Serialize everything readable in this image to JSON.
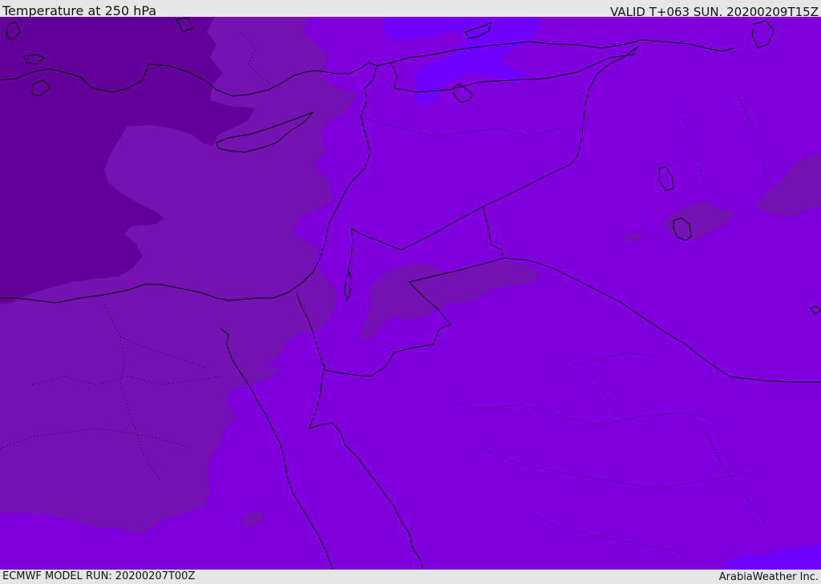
{
  "header": {
    "title": "Temperature at 250 hPa",
    "valid_time": "VALID T+063 SUN. 20200209T15Z"
  },
  "footer": {
    "model_run": "ECMWF MODEL RUN: 20200207T00Z",
    "credit": "ArabiaWeather Inc."
  },
  "colors": {
    "field_dark": "#63009a",
    "field_mid": "#7412b4",
    "field_base": "#7f00dd",
    "field_light": "#7000ff",
    "coastline": "#000000",
    "frame": "#e6e6e6"
  }
}
